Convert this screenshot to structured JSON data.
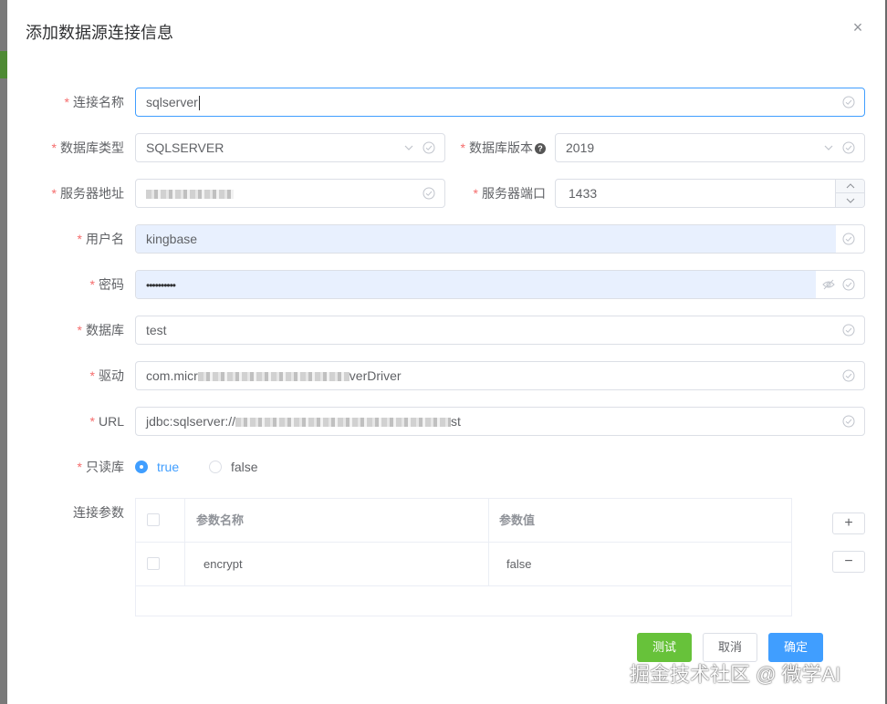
{
  "dialog": {
    "title": "添加数据源连接信息",
    "close_glyph": "×"
  },
  "form": {
    "required_mark": "*",
    "conn_name": {
      "label": "连接名称",
      "value": "sqlserver"
    },
    "db_type": {
      "label": "数据库类型",
      "value": "SQLSERVER"
    },
    "db_version": {
      "label": "数据库版本",
      "help": "?",
      "value": "2019"
    },
    "server_addr": {
      "label": "服务器地址"
    },
    "server_port": {
      "label": "服务器端口",
      "value": "1433"
    },
    "username": {
      "label": "用户名",
      "value": "kingbase"
    },
    "password": {
      "label": "密码",
      "value": "••••••••••"
    },
    "database": {
      "label": "数据库",
      "value": "test"
    },
    "driver": {
      "label": "驱动",
      "value_prefix": "com.micr",
      "value_suffix": "verDriver"
    },
    "url": {
      "label": "URL",
      "value_prefix": "jdbc:sqlserver://",
      "value_suffix": "st"
    },
    "readonly": {
      "label": "只读库",
      "options": [
        "true",
        "false"
      ],
      "selected": "true"
    },
    "conn_params": {
      "label": "连接参数"
    }
  },
  "params_table": {
    "headers": [
      "参数名称",
      "参数值"
    ],
    "rows": [
      {
        "name": "encrypt",
        "value": "false"
      }
    ]
  },
  "side_buttons": {
    "add": "+",
    "remove": "−"
  },
  "footer": {
    "test": "测试",
    "cancel": "取消",
    "confirm": "确定"
  },
  "watermark": "掘金技术社区 @ 微学AI",
  "colors": {
    "primary": "#409eff",
    "success": "#67c23a",
    "danger": "#f56c6c",
    "autofill": "#e8f0fe"
  }
}
